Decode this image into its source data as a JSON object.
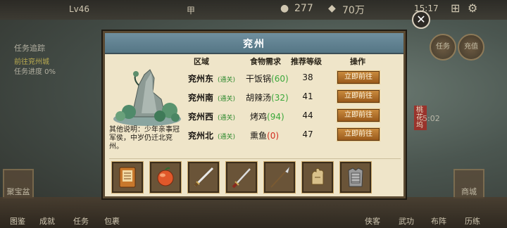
{
  "hud": {
    "player_level": "Lv46",
    "gold": "277",
    "silver": "70万",
    "clock": "15:17",
    "center_char": "甲",
    "quest_title": "任务追踪",
    "quest_line": "前往兖州城",
    "quest_progress": "任务进度 0%",
    "left_bottom_label": "聚宝盆",
    "right_bottom_label": "商城",
    "timer": "5:02",
    "right_tag": "桃花坞",
    "bottom_buttons": [
      "图鉴",
      "成就",
      "任务",
      "包裹",
      "侠客",
      "武功",
      "布阵",
      "历练"
    ],
    "top_right_buttons": [
      "任务",
      "充值"
    ]
  },
  "dialog": {
    "title": "兖州",
    "description": "其他说明：少年亲事冠军侯，中岁仍迁北兖州。",
    "headers": {
      "region": "区域",
      "food": "食物需求",
      "level": "推荐等级",
      "action": "操作"
    },
    "rows": [
      {
        "region": "兖州东",
        "status": "(通关)",
        "food": "干饭锅",
        "food_count": "(60)",
        "level": "38",
        "action": "立即前往"
      },
      {
        "region": "兖州南",
        "status": "(通关)",
        "food": "胡辣汤",
        "food_count": "(32)",
        "level": "41",
        "action": "立即前往"
      },
      {
        "region": "兖州西",
        "status": "(通关)",
        "food": "烤鸡",
        "food_count": "(94)",
        "level": "44",
        "action": "立即前往"
      },
      {
        "region": "兖州北",
        "status": "(通关)",
        "food": "熏鱼",
        "food_count": "(0)",
        "level": "47",
        "action": "立即前往"
      }
    ],
    "items": [
      "book",
      "orange-fruit",
      "saber",
      "sword",
      "spear",
      "gauntlet",
      "armor"
    ]
  },
  "colors": {
    "title_bar": "#6f8f9f",
    "pass_green": "#2f8a2f",
    "count_green": "#3aa83a",
    "count_red": "#d22b1f",
    "button_orange": "#b5702b"
  }
}
